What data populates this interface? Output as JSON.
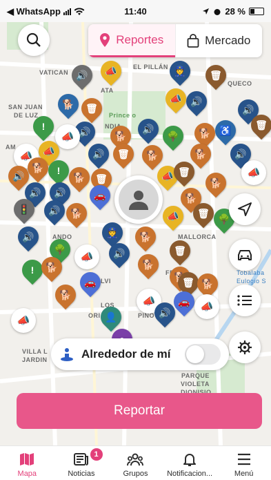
{
  "status_bar": {
    "back_app": "◀ WhatsApp",
    "time": "11:40",
    "battery": "28 %"
  },
  "segmented": {
    "reportes_label": "Reportes",
    "mercado_label": "Mercado"
  },
  "map": {
    "labels": {
      "vaticano": "VATICAN",
      "el_pillan": "EL PILLÁN",
      "quecco": "QUECO",
      "san_juan": "SAN JUAN",
      "de_luz": "DE LUZ",
      "prince": "Prince o",
      "am": "AM",
      "mallorca": "MALLORCA",
      "lvi": "LVI",
      "los": "LOS",
      "ori": "ORI",
      "fe": "FE",
      "villa": "VILLA L",
      "jardin": "JARDIN",
      "parque": "PARQUE",
      "violeta": "VIOLETA",
      "dionisio": "DIONISIO",
      "tobalaba": "Tobalaba",
      "eulogio": "Eulogio S",
      "ata": "ATA",
      "ndia": "NDIA",
      "ando": "ANDO",
      "pino": "PINO"
    },
    "pin_colors": {
      "orange": "#c9732e",
      "blue": "#27538a",
      "green": "#3c9a48",
      "yellow": "#e8b424",
      "grey": "#6d6d6d",
      "brown": "#8a5a2e",
      "teal": "#2f8a7a",
      "purple": "#7a3fa8",
      "pink_circle": "#e3407a",
      "car_blue": "#4d6fd6"
    }
  },
  "near_me": {
    "label": "Alrededor de mí",
    "enabled": false
  },
  "report_button": {
    "label": "Reportar"
  },
  "tabs": [
    {
      "label": "Mapa",
      "icon": "map-icon",
      "active": true
    },
    {
      "label": "Noticias",
      "icon": "news-icon",
      "badge": "1"
    },
    {
      "label": "Grupos",
      "icon": "groups-icon"
    },
    {
      "label": "Notificacion...",
      "icon": "bell-icon"
    },
    {
      "label": "Menú",
      "icon": "menu-icon"
    }
  ],
  "colors": {
    "accent": "#e3407a",
    "button": "#e8578a"
  }
}
